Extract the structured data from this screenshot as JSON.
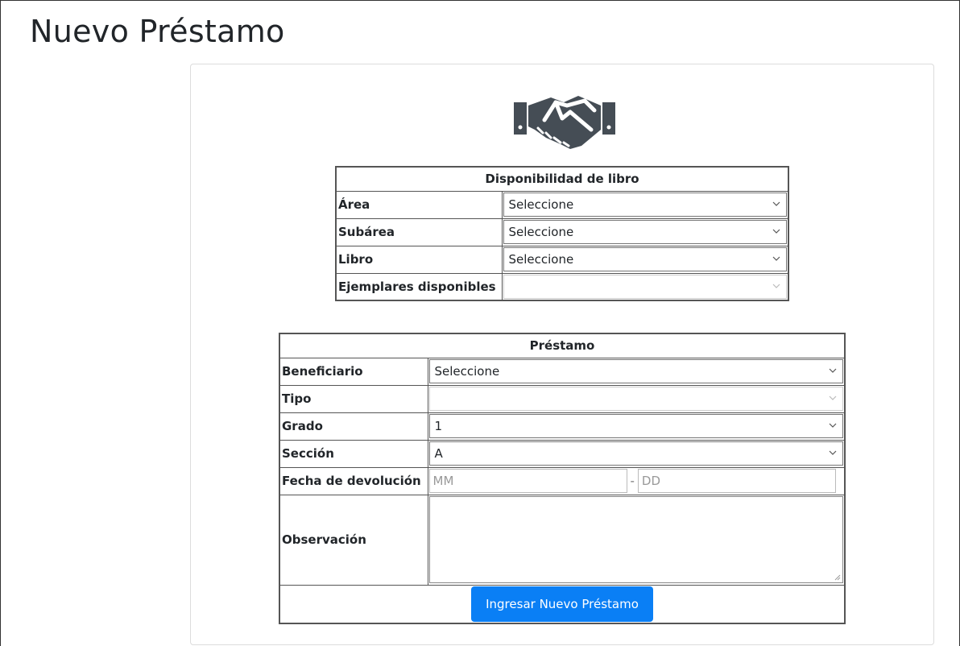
{
  "page": {
    "title": "Nuevo Préstamo"
  },
  "availability": {
    "header": "Disponibilidad de libro",
    "rows": [
      {
        "label": "Área",
        "value": "Seleccione",
        "disabled": false
      },
      {
        "label": "Subárea",
        "value": "Seleccione",
        "disabled": false
      },
      {
        "label": "Libro",
        "value": "Seleccione",
        "disabled": false
      },
      {
        "label": "Ejemplares disponibles",
        "value": "",
        "disabled": true
      }
    ]
  },
  "loan": {
    "header": "Préstamo",
    "beneficiario": {
      "label": "Beneficiario",
      "value": "Seleccione"
    },
    "tipo": {
      "label": "Tipo",
      "value": ""
    },
    "grado": {
      "label": "Grado",
      "value": "1"
    },
    "seccion": {
      "label": "Sección",
      "value": "A"
    },
    "fecha": {
      "label": "Fecha de devolución",
      "month_placeholder": "MM",
      "separator": "-",
      "day_placeholder": "DD"
    },
    "observacion": {
      "label": "Observación",
      "value": ""
    },
    "submit_label": "Ingresar Nuevo Préstamo"
  },
  "icons": {
    "handshake": "handshake-icon",
    "chevron": "chevron-down-icon"
  },
  "colors": {
    "primary": "#0a7ff5",
    "icon": "#454d55"
  }
}
